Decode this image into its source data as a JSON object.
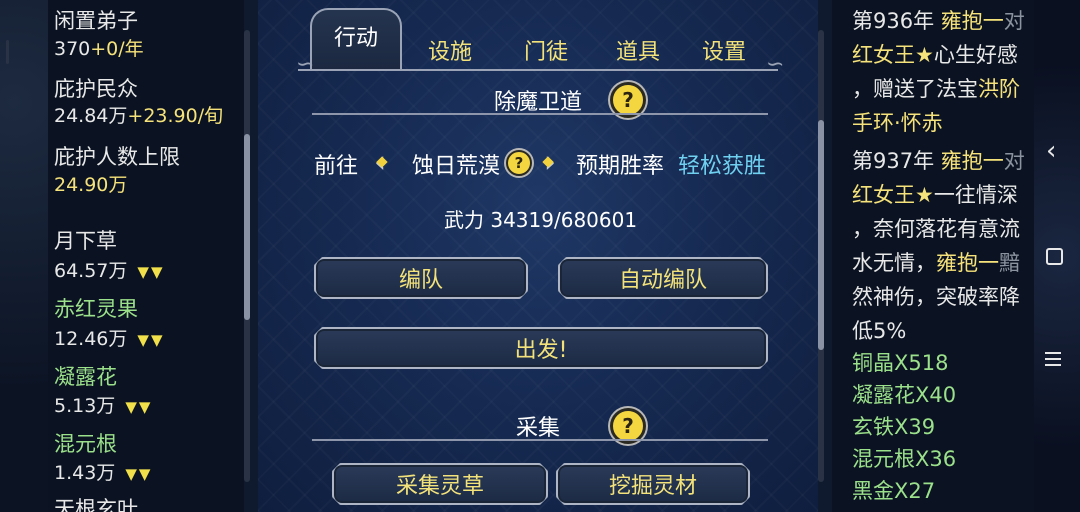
{
  "left_panel": {
    "idle_disciples_label": "闲置弟子",
    "idle_disciples_value": "370",
    "idle_disciples_rate": "+0/年",
    "protected_people_label": "庇护民众",
    "protected_people_value": "24.84万",
    "protected_people_rate": "+23.90/旬",
    "protect_limit_label": "庇护人数上限",
    "protect_limit_value": "24.90万",
    "resources": [
      {
        "name": "月下草",
        "amount": "64.57万",
        "trend": "▼▼"
      },
      {
        "name": "赤红灵果",
        "amount": "12.46万",
        "trend": "▼▼"
      },
      {
        "name": "凝露花",
        "amount": "5.13万",
        "trend": "▼▼"
      },
      {
        "name": "混元根",
        "amount": "1.43万",
        "trend": "▼▼"
      },
      {
        "name": "天根玄叶"
      }
    ]
  },
  "tabs": [
    "行动",
    "设施",
    "门徒",
    "道具",
    "设置"
  ],
  "mission": {
    "section_title": "除魔卫道",
    "goto_label": "前往",
    "location": "蚀日荒漠",
    "win_rate_label": "预期胜率",
    "win_rate_value": "轻松获胜",
    "power_text": "武力 34319/680601",
    "formation_button": "编队",
    "auto_formation_button": "自动编队",
    "depart_button": "出发!"
  },
  "gather": {
    "section_title": "采集",
    "herb_button": "采集灵草",
    "mine_button": "挖掘灵材"
  },
  "help_mark": "?",
  "log": {
    "entry1": {
      "year": "第936年",
      "actor": "雍抱一",
      "line1_end": "对",
      "line2a": "红女王★",
      "line2b": "心生好感",
      "line3a": "，赠送了法宝",
      "line3b": "洪阶",
      "line4": "手环·怀赤"
    },
    "entry2": {
      "year": "第937年",
      "actor": "雍抱一",
      "line1_end": "对",
      "line2a": "红女王★",
      "line2b": "一往情深",
      "line3": "，奈何落花有意流",
      "line4": "水无情，",
      "line4_name": "雍抱一",
      "line4_end": "黯",
      "line5": "然神伤，突破率降",
      "line6": "低5%"
    },
    "items": [
      "铜晶X518",
      "凝露花X40",
      "玄铁X39",
      "混元根X36",
      "黑金X27"
    ]
  },
  "colors": {
    "accent_yellow": "#f3e27a",
    "name_red": "#e05a4a",
    "rate_cyan": "#6fd0ef",
    "item_green": "#9be08a"
  },
  "icons": {
    "back": "chevron-left-icon",
    "home": "square-icon",
    "menu": "menu-icon"
  }
}
